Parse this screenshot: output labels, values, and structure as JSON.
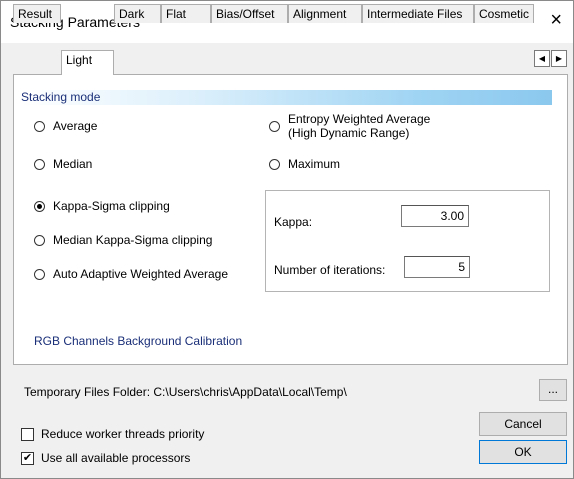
{
  "window": {
    "title": "Stacking Parameters",
    "close_glyph": "×"
  },
  "tabs": [
    {
      "label": "Result"
    },
    {
      "label": "Light",
      "active": true
    },
    {
      "label": "Dark"
    },
    {
      "label": "Flat"
    },
    {
      "label": "Bias/Offset"
    },
    {
      "label": "Alignment"
    },
    {
      "label": "Intermediate Files"
    },
    {
      "label": "Cosmetic"
    }
  ],
  "tab_scroll": {
    "left_glyph": "◀",
    "right_glyph": "▶"
  },
  "stacking_mode": {
    "header": "Stacking mode",
    "options": [
      {
        "label": "Average",
        "selected": false
      },
      {
        "label": "Median",
        "selected": false
      },
      {
        "label": "Kappa-Sigma clipping",
        "selected": true
      },
      {
        "label": "Median Kappa-Sigma clipping",
        "selected": false
      },
      {
        "label": "Auto Adaptive Weighted Average",
        "selected": false
      },
      {
        "label": "Entropy Weighted Average\n(High Dynamic Range)",
        "selected": false
      },
      {
        "label": "Maximum",
        "selected": false
      }
    ]
  },
  "kappa": {
    "label": "Kappa:",
    "value": "3.00"
  },
  "iterations": {
    "label": "Number of iterations:",
    "value": "5"
  },
  "rgb_link": "RGB Channels Background Calibration",
  "temp_folder": {
    "label": "Temporary Files Folder:",
    "path": "C:\\Users\\chris\\AppData\\Local\\Temp\\",
    "browse_label": "..."
  },
  "options": {
    "reduce_priority": {
      "label": "Reduce worker threads priority",
      "checked": false
    },
    "use_all_processors": {
      "label": "Use all available processors",
      "checked": true
    }
  },
  "buttons": {
    "cancel": "Cancel",
    "ok": "OK"
  }
}
